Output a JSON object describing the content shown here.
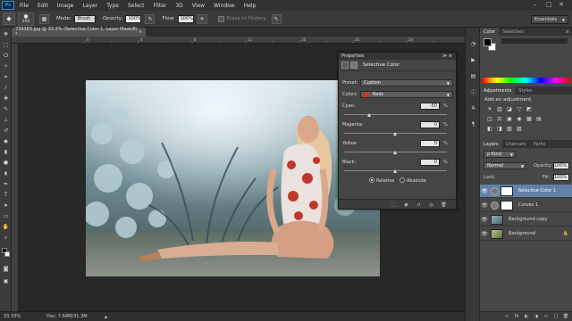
{
  "app": {
    "logo": "Ps"
  },
  "menu": [
    "File",
    "Edit",
    "Image",
    "Layer",
    "Type",
    "Select",
    "Filter",
    "3D",
    "View",
    "Window",
    "Help"
  ],
  "window_controls": {
    "minimize": "–",
    "maximize": "□",
    "close": "✕"
  },
  "options_bar": {
    "brush_size": "260",
    "mode_label": "Mode:",
    "mode_value": "Brush",
    "opacity_label": "Opacity:",
    "opacity_value": "100%",
    "flow_label": "Flow:",
    "flow_value": "100%",
    "erase_to_history": "Erase to History",
    "workspace": "Essentials"
  },
  "document": {
    "tab_title": "739383.jpg @ 33.3% (Selective Color 1, Layer Mask/8) *",
    "close": "×"
  },
  "ruler_ticks": [
    "0",
    "2",
    "4",
    "6",
    "8",
    "10",
    "12",
    "14",
    "16",
    "18",
    "20",
    "22",
    "24",
    "26"
  ],
  "status": {
    "zoom": "33.33%",
    "doc": "Doc: 7.64M/31.3M",
    "arrow": "▶"
  },
  "properties": {
    "header": "Properties",
    "header_ctrl": "≫ ≡",
    "title": "Selective Color",
    "preset_label": "Preset:",
    "preset_value": "Custom",
    "colors_label": "Colors:",
    "colors_value": "Reds",
    "colors_swatch": "#e0301e",
    "sliders": [
      {
        "label": "Cyan:",
        "value": "-50",
        "fraction": 0.25
      },
      {
        "label": "Magenta:",
        "value": "0",
        "fraction": 0.5
      },
      {
        "label": "Yellow:",
        "value": "0",
        "fraction": 0.5
      },
      {
        "label": "Black:",
        "value": "0",
        "fraction": 0.5
      }
    ],
    "percent": "%",
    "relative": "Relative",
    "absolute": "Absolute",
    "method_selected": "relative"
  },
  "color_panel": {
    "tabs": [
      "Color",
      "Swatches"
    ],
    "menu": "≡"
  },
  "adjustments": {
    "tabs": [
      "Adjustments",
      "Styles"
    ],
    "add_label": "Add an adjustment",
    "icons_row1": [
      "☀",
      "▥",
      "◪",
      "▽",
      "◩"
    ],
    "icons_row2": [
      "◫",
      "⚖",
      "▣",
      "◉",
      "▦",
      "▤"
    ],
    "icons_row3": [
      "◧",
      "◨",
      "▧",
      "▨"
    ]
  },
  "layers": {
    "tabs": [
      "Layers",
      "Channels",
      "Paths"
    ],
    "kind_label": "ρ Kind",
    "blend_mode": "Normal",
    "opacity_label": "Opacity:",
    "opacity_value": "100%",
    "lock_label": "Lock:",
    "fill_label": "Fill:",
    "fill_value": "100%",
    "rows": [
      {
        "name": "Selective Color 1",
        "selected": true
      },
      {
        "name": "Curves 1",
        "selected": false
      },
      {
        "name": "Background copy",
        "selected": false
      },
      {
        "name": "Background",
        "selected": false,
        "italic": true
      }
    ],
    "footer_icons": [
      "∞",
      "fx",
      "◐",
      "◑",
      "▭",
      "▢",
      "🗑"
    ]
  }
}
